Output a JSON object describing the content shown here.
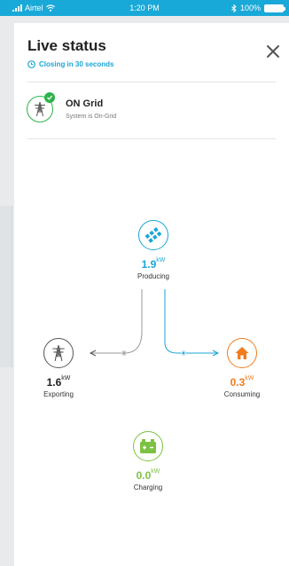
{
  "status_bar": {
    "carrier": "Airtel",
    "time": "1:20 PM",
    "battery": "100%",
    "color": "#19a9d8"
  },
  "header": {
    "title": "Live status",
    "closing_text": "Closing in 30 seconds",
    "close_icon": "close-icon"
  },
  "grid_status": {
    "name": "ON Grid",
    "description": "System is On-Grid",
    "icon": "power-tower-icon",
    "badge_icon": "check-icon",
    "color": "#2db34a"
  },
  "flow": {
    "solar": {
      "value": "1.9",
      "unit": "kW",
      "label": "Producing",
      "icon": "solar-panel-icon",
      "color": "#1aa6d6"
    },
    "grid": {
      "value": "1.6",
      "unit": "kW",
      "label": "Exporting",
      "icon": "power-tower-icon",
      "color": "#555555"
    },
    "home": {
      "value": "0.3",
      "unit": "kW",
      "label": "Consuming",
      "icon": "home-icon",
      "color": "#f07c1d"
    },
    "battery": {
      "value": "0.0",
      "unit": "kW",
      "label": "Charging",
      "icon": "battery-icon",
      "color": "#7cc242"
    }
  }
}
